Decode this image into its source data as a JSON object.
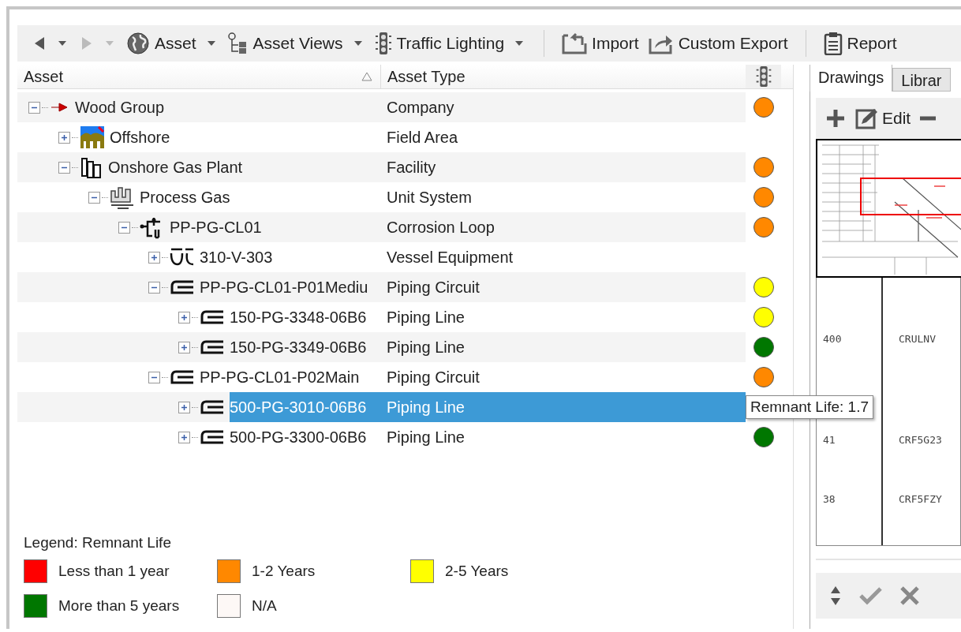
{
  "toolbar": {
    "nav": [
      {
        "kind": "back",
        "disabled": false
      },
      {
        "kind": "forward",
        "disabled": true
      }
    ],
    "groups": [
      [
        {
          "label": "Asset",
          "kind": "globe",
          "dropdown": true
        },
        {
          "label": "Asset Views",
          "kind": "views",
          "dropdown": true
        },
        {
          "label": "Traffic Lighting",
          "kind": "traffic",
          "dropdown": true
        }
      ],
      [
        {
          "label": "Import",
          "kind": "import",
          "dropdown": false
        },
        {
          "label": "Custom Export",
          "kind": "export",
          "dropdown": false
        }
      ],
      [
        {
          "label": "Report",
          "kind": "report",
          "dropdown": false
        }
      ]
    ]
  },
  "columns": [
    {
      "label": "Asset",
      "sorted": true
    },
    {
      "label": "Asset Type",
      "sorted": false
    }
  ],
  "tree": [
    {
      "name": "Wood Group",
      "type": "Company",
      "kind": "company",
      "expanded": true,
      "selected": false,
      "color": "#ff8800",
      "children": [
        {
          "name": "Offshore",
          "type": "Field Area",
          "kind": "field",
          "expanded": false,
          "selected": false
        },
        {
          "name": "Onshore Gas Plant",
          "type": "Facility",
          "kind": "facility",
          "expanded": true,
          "selected": false,
          "color": "#ff8800",
          "children": [
            {
              "name": "Process Gas",
              "type": "Unit System",
              "kind": "unit",
              "expanded": true,
              "selected": false,
              "color": "#ff8800",
              "children": [
                {
                  "name": "PP-PG-CL01",
                  "type": "Corrosion Loop",
                  "kind": "loop",
                  "expanded": true,
                  "selected": false,
                  "color": "#ff8800",
                  "children": [
                    {
                      "name": "310-V-303",
                      "type": "Vessel Equipment",
                      "kind": "vessel",
                      "expanded": false,
                      "selected": false
                    },
                    {
                      "name": "PP-PG-CL01-P01Mediu",
                      "type": "Piping Circuit",
                      "kind": "pipe",
                      "expanded": true,
                      "selected": false,
                      "color": "#ffff00",
                      "children": [
                        {
                          "name": "150-PG-3348-06B6",
                          "type": "Piping Line",
                          "kind": "pipe",
                          "expanded": false,
                          "selected": false,
                          "color": "#ffff00"
                        },
                        {
                          "name": "150-PG-3349-06B6",
                          "type": "Piping Line",
                          "kind": "pipe",
                          "expanded": false,
                          "selected": false,
                          "color": "#007700"
                        }
                      ]
                    },
                    {
                      "name": "PP-PG-CL01-P02Main",
                      "type": "Piping Circuit",
                      "kind": "pipe",
                      "expanded": true,
                      "selected": false,
                      "color": "#ff8800",
                      "children": [
                        {
                          "name": "500-PG-3010-06B6",
                          "type": "Piping Line",
                          "kind": "pipe",
                          "expanded": false,
                          "selected": true
                        },
                        {
                          "name": "500-PG-3300-06B6",
                          "type": "Piping Line",
                          "kind": "pipe",
                          "expanded": false,
                          "selected": false,
                          "color": "#007700"
                        }
                      ]
                    }
                  ]
                }
              ]
            }
          ]
        }
      ]
    }
  ],
  "tooltip": {
    "text": "Remnant Life: 1.7"
  },
  "legend": {
    "title": "Legend: Remnant Life",
    "items": [
      {
        "label": "Less than 1 year",
        "color": "#ff0000"
      },
      {
        "label": "1-2 Years",
        "color": "#ff8800"
      },
      {
        "label": "2-5 Years",
        "color": "#ffff00"
      },
      {
        "label": "More than 5 years",
        "color": "#007700"
      },
      {
        "label": "N/A",
        "color": "#fdf8f6"
      }
    ]
  },
  "side": {
    "tabs": [
      {
        "label": "Drawings",
        "selected": true
      },
      {
        "label": "Librar",
        "selected": false
      }
    ],
    "edit_label": "Edit",
    "drawing_rows": [
      {
        "col_1": "400",
        "col_2": "CRULNV"
      },
      {
        "col_1": "41",
        "col_2": "CRF5G23"
      },
      {
        "col_1": "38",
        "col_2": "CRF5FZY"
      }
    ]
  }
}
